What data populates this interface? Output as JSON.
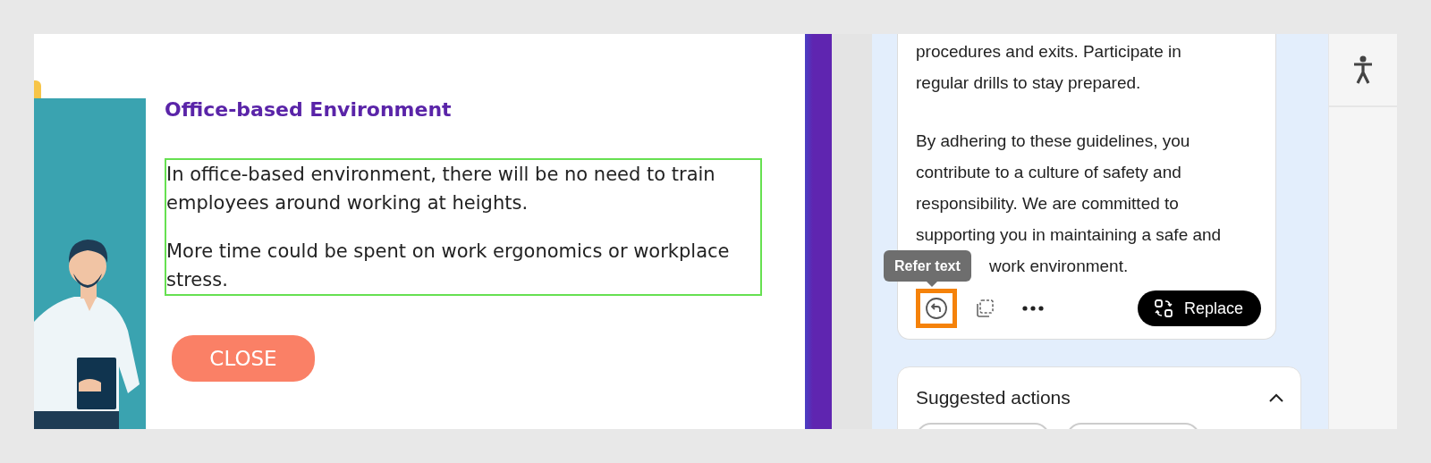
{
  "slide": {
    "title": "Office-based Environment",
    "paragraphs": [
      "In office-based environment, there will be no need to train employees around working at heights.",
      "More time could be spent on work ergonomics or workplace stress."
    ],
    "close_button": "CLOSE"
  },
  "assistant": {
    "paragraphs": [
      [
        "procedures and exits. Participate in",
        "regular drills to stay prepared."
      ],
      [
        "By adhering to these guidelines, you",
        "contribute to a culture of safety and",
        "responsibility. We are committed to",
        "supporting you in maintaining a safe and",
        "work environment."
      ]
    ],
    "tooltip": "Refer text",
    "actions": [
      {
        "kind": "refer",
        "selected": true
      },
      {
        "kind": "copy",
        "selected": false
      },
      {
        "kind": "more",
        "selected": false
      }
    ],
    "replace_button": "Replace",
    "suggested": {
      "title": "Suggested actions",
      "expanded": true
    }
  }
}
